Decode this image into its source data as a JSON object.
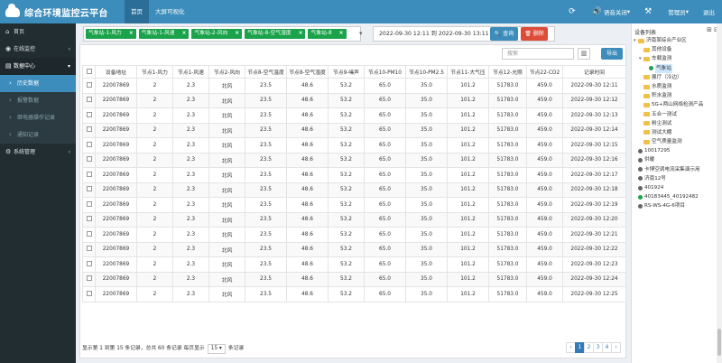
{
  "app": {
    "title": "综合环境监控云平台"
  },
  "topnav": [
    {
      "label": "首页",
      "active": true
    },
    {
      "label": "大屏可视化",
      "active": false
    }
  ],
  "topright": {
    "refresh_icon": "refresh-icon",
    "voice_label": "语音关闭",
    "settings_icon": "gear-icon",
    "user_label": "管理员",
    "logout_label": "退出"
  },
  "sidebar": [
    {
      "label": "首页",
      "icon": "home-icon",
      "glyph": "⌂"
    },
    {
      "label": "在线监控",
      "icon": "monitor-icon",
      "glyph": "◉",
      "arrow": "‹"
    },
    {
      "label": "数据中心",
      "icon": "data-icon",
      "glyph": "▤",
      "arrow": "▾",
      "open": true,
      "children": [
        {
          "label": "历史数据",
          "active": true
        },
        {
          "label": "报警数据"
        },
        {
          "label": "继电器操作记录"
        },
        {
          "label": "通知记录"
        }
      ]
    },
    {
      "label": "系统管理",
      "icon": "settings-icon",
      "glyph": "⚙",
      "arrow": "‹"
    }
  ],
  "filter": {
    "tags": [
      "气象站-1-风力",
      "气象站-1-风速",
      "气象站-2-风向",
      "气象站-8-空气湿度",
      "气象站-8"
    ],
    "date_range": "2022-09-30 12:11 到 2022-09-30 13:11",
    "query_label": "查询",
    "delete_label": "删除"
  },
  "table": {
    "search_placeholder": "搜索",
    "export_label": "导出",
    "columns": [
      "设备地址",
      "节点1-风力",
      "节点1-风速",
      "节点2-风向",
      "节点8-空气温度",
      "节点8-空气湿度",
      "节点9-噪声",
      "节点10-PM10",
      "节点10-PM2.5",
      "节点11-大气压",
      "节点12-光照",
      "节点22-CO2",
      "记录时间"
    ],
    "rows": [
      [
        "22007869",
        "2",
        "2.3",
        "北风",
        "23.5",
        "48.6",
        "53.2",
        "65.0",
        "35.0",
        "101.2",
        "51783.0",
        "459.0",
        "2022-09-30 12:11"
      ],
      [
        "22007869",
        "2",
        "2.3",
        "北风",
        "23.5",
        "48.6",
        "53.2",
        "65.0",
        "35.0",
        "101.2",
        "51783.0",
        "459.0",
        "2022-09-30 12:12"
      ],
      [
        "22007869",
        "2",
        "2.3",
        "北风",
        "23.5",
        "48.6",
        "53.2",
        "65.0",
        "35.0",
        "101.2",
        "51783.0",
        "459.0",
        "2022-09-30 12:13"
      ],
      [
        "22007869",
        "2",
        "2.3",
        "北风",
        "23.5",
        "48.6",
        "53.2",
        "65.0",
        "35.0",
        "101.2",
        "51783.0",
        "459.0",
        "2022-09-30 12:14"
      ],
      [
        "22007869",
        "2",
        "2.3",
        "北风",
        "23.5",
        "48.6",
        "53.2",
        "65.0",
        "35.0",
        "101.2",
        "51783.0",
        "459.0",
        "2022-09-30 12:15"
      ],
      [
        "22007869",
        "2",
        "2.3",
        "北风",
        "23.5",
        "48.6",
        "53.2",
        "65.0",
        "35.0",
        "101.2",
        "51783.0",
        "459.0",
        "2022-09-30 12:16"
      ],
      [
        "22007869",
        "2",
        "2.3",
        "北风",
        "23.5",
        "48.6",
        "53.2",
        "65.0",
        "35.0",
        "101.2",
        "51783.0",
        "459.0",
        "2022-09-30 12:17"
      ],
      [
        "22007869",
        "2",
        "2.3",
        "北风",
        "23.5",
        "48.6",
        "53.2",
        "65.0",
        "35.0",
        "101.2",
        "51783.0",
        "459.0",
        "2022-09-30 12:18"
      ],
      [
        "22007869",
        "2",
        "2.3",
        "北风",
        "23.5",
        "48.6",
        "53.2",
        "65.0",
        "35.0",
        "101.2",
        "51783.0",
        "459.0",
        "2022-09-30 12:19"
      ],
      [
        "22007869",
        "2",
        "2.3",
        "北风",
        "23.5",
        "48.6",
        "53.2",
        "65.0",
        "35.0",
        "101.2",
        "51783.0",
        "459.0",
        "2022-09-30 12:20"
      ],
      [
        "22007869",
        "2",
        "2.3",
        "北风",
        "23.5",
        "48.6",
        "53.2",
        "65.0",
        "35.0",
        "101.2",
        "51783.0",
        "459.0",
        "2022-09-30 12:21"
      ],
      [
        "22007869",
        "2",
        "2.3",
        "北风",
        "23.5",
        "48.6",
        "53.2",
        "65.0",
        "35.0",
        "101.2",
        "51783.0",
        "459.0",
        "2022-09-30 12:22"
      ],
      [
        "22007869",
        "2",
        "2.3",
        "北风",
        "23.5",
        "48.6",
        "53.2",
        "65.0",
        "35.0",
        "101.2",
        "51783.0",
        "459.0",
        "2022-09-30 12:23"
      ],
      [
        "22007869",
        "2",
        "2.3",
        "北风",
        "23.5",
        "48.6",
        "53.2",
        "65.0",
        "35.0",
        "101.2",
        "51783.0",
        "459.0",
        "2022-09-30 12:24"
      ],
      [
        "22007869",
        "2",
        "2.3",
        "北风",
        "23.5",
        "48.6",
        "53.2",
        "65.0",
        "35.0",
        "101.2",
        "51783.0",
        "459.0",
        "2022-09-30 12:25"
      ]
    ]
  },
  "pager": {
    "info": "显示第 1 到第 15 条记录，总共 60 条记录 每页显示",
    "page_size": "15",
    "suffix": "条记录",
    "pages": [
      "‹",
      "1",
      "2",
      "3",
      "4",
      "›"
    ],
    "active_page": "1"
  },
  "tree": {
    "title": "设备列表",
    "title_icons": "⊞ ⊟",
    "nodes": [
      {
        "label": "济南某综合产业区",
        "type": "folder",
        "level": 0,
        "toggle": "▾"
      },
      {
        "label": "其他设备",
        "type": "folder",
        "level": 1
      },
      {
        "label": "车载监测",
        "type": "folder",
        "level": 1,
        "toggle": "▾"
      },
      {
        "label": "气象站",
        "type": "dot-green",
        "level": 2,
        "selected": true
      },
      {
        "label": "展厅（冷边）",
        "type": "folder",
        "level": 1
      },
      {
        "label": "水质监测",
        "type": "folder",
        "level": 1
      },
      {
        "label": "积水监测",
        "type": "folder",
        "level": 1
      },
      {
        "label": "5G+两山网络检测产品",
        "type": "folder",
        "level": 1
      },
      {
        "label": "五合一测试",
        "type": "folder",
        "level": 1
      },
      {
        "label": "粉尘测试",
        "type": "folder",
        "level": 1
      },
      {
        "label": "测试大棚",
        "type": "folder",
        "level": 1
      },
      {
        "label": "空气质量监测",
        "type": "folder",
        "level": 1
      },
      {
        "label": "10017295",
        "type": "dot",
        "level": 0
      },
      {
        "label": "供暖",
        "type": "dot",
        "level": 0
      },
      {
        "label": "卡博空调电流采集演示用",
        "type": "dot",
        "level": 0
      },
      {
        "label": "济南12号",
        "type": "dot",
        "level": 0
      },
      {
        "label": "401924",
        "type": "dot",
        "level": 0
      },
      {
        "label": "40183445_40192482",
        "type": "dot-green",
        "level": 0
      },
      {
        "label": "RS-WS-4G-6项目",
        "type": "dot",
        "level": 0
      }
    ]
  }
}
